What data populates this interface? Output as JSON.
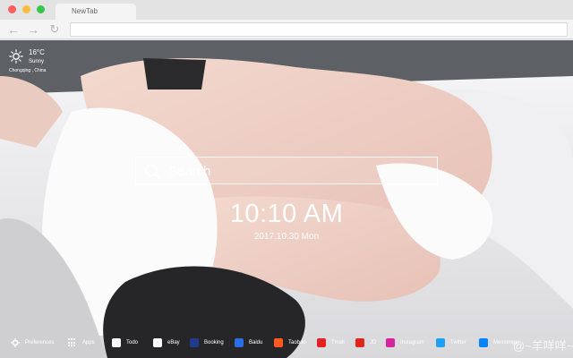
{
  "browser": {
    "tab_title": "NewTab",
    "nav": {
      "back_icon": "arrow-left-icon",
      "forward_icon": "arrow-right-icon",
      "reload_icon": "reload-icon"
    },
    "address": ""
  },
  "weather": {
    "icon": "sun-icon",
    "temperature": "16°C",
    "condition": "Sunny",
    "location": "Chongqing , China"
  },
  "search": {
    "placeholder": "Search",
    "icon": "search-icon"
  },
  "clock": {
    "time": "10:10 AM",
    "date": "2017.10.30 Mon"
  },
  "bottom_bar": {
    "preferences": {
      "label": "Preferences",
      "icon": "gear-icon"
    },
    "apps": {
      "label": "Apps",
      "icon": "apps-grid-icon"
    },
    "shortcuts": [
      {
        "label": "Todo",
        "icon": "todo-check-icon",
        "color": "#ffffff"
      },
      {
        "label": "eBay",
        "icon": "ebay-icon",
        "color": "#ffffff"
      },
      {
        "label": "Booking",
        "icon": "booking-icon",
        "color": "#1f3d8c"
      },
      {
        "label": "Baidu",
        "icon": "baidu-icon",
        "color": "#2b6de3"
      },
      {
        "label": "Taobao",
        "icon": "taobao-icon",
        "color": "#ff5a1f"
      },
      {
        "label": "Tmall",
        "icon": "tmall-icon",
        "color": "#e22222"
      },
      {
        "label": "JD",
        "icon": "jd-icon",
        "color": "#e1251b"
      },
      {
        "label": "Instagram",
        "icon": "instagram-icon",
        "color": "#d6249f"
      },
      {
        "label": "Twitter",
        "icon": "twitter-icon",
        "color": "#1da1f2"
      },
      {
        "label": "Messenger",
        "icon": "messenger-icon",
        "color": "#0084ff"
      }
    ]
  },
  "watermark": "@~羊咩咩~"
}
